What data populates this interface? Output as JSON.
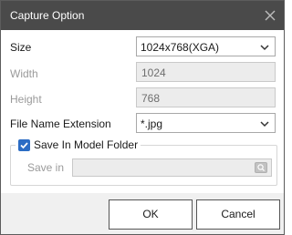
{
  "dialog": {
    "title": "Capture Option",
    "close_icon": "close-icon"
  },
  "size": {
    "label": "Size",
    "value": "1024x768(XGA)"
  },
  "width": {
    "label": "Width",
    "value": "1024"
  },
  "height": {
    "label": "Height",
    "value": "768"
  },
  "extension": {
    "label": "File Name Extension",
    "value": "*.jpg"
  },
  "model_folder": {
    "label": "Save In Model Folder",
    "checked": true
  },
  "save_in": {
    "label": "Save in",
    "value": "",
    "browse_icon": "browse-folder-icon"
  },
  "buttons": {
    "ok": "OK",
    "cancel": "Cancel"
  },
  "colors": {
    "titlebar": "#4a4a4a",
    "checkbox": "#2b6cc4",
    "footer": "#f0f0f0"
  }
}
